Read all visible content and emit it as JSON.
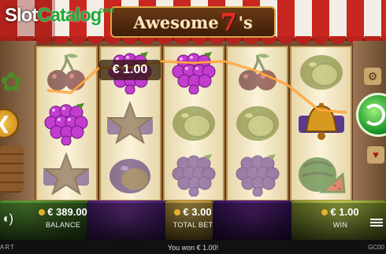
{
  "watermark": {
    "slot": "Slot",
    "catalog": "Catalog",
    "com": ".com"
  },
  "logo": {
    "word": "Awesome",
    "seven": "7",
    "suffix": "'s"
  },
  "reels": [
    [
      "cherries",
      "grapes",
      "star"
    ],
    [
      "grapes",
      "star",
      "plum"
    ],
    [
      "grapes",
      "lemon",
      "grapes"
    ],
    [
      "cherries",
      "lemon",
      "grapes"
    ],
    [
      "lemon",
      "bell",
      "watermelon"
    ]
  ],
  "winning_cells": [
    [
      1,
      0
    ],
    [
      2,
      0
    ],
    [
      0,
      1
    ],
    [
      4,
      1
    ]
  ],
  "win_amount_overlay": "€ 1.00",
  "hud": {
    "sound_icon": "speaker-icon",
    "balance_value": "€ 389.00",
    "balance_label": "BALANCE",
    "bet_value": "€ 3.00",
    "bet_label": "TOTAL BET",
    "win_value": "€ 1.00",
    "win_label": "WIN"
  },
  "status": {
    "brand": "ART",
    "message": "You won € 1.00!",
    "code": "GC00"
  },
  "colors": {
    "win_line": "#ff8a1a",
    "spin_button": "#1c9a2a",
    "awning_red": "#c8261f"
  }
}
